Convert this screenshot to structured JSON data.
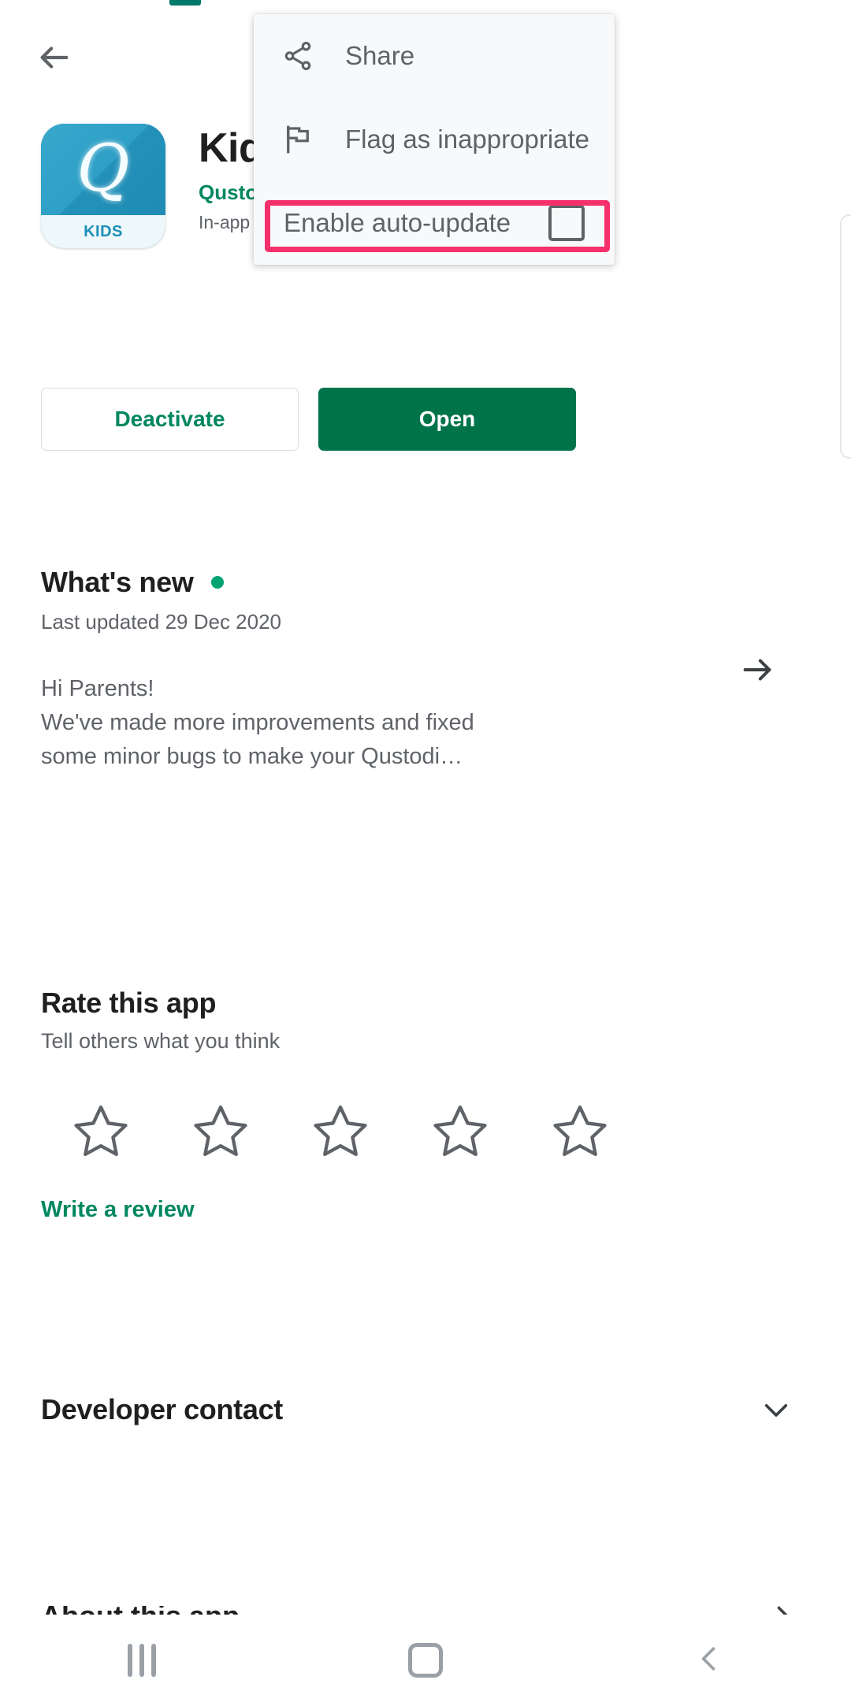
{
  "app": {
    "back_label": "Back",
    "title": "Kids",
    "developer": "Qustodio",
    "iap_note": "In-app purchases",
    "icon_letter": "Q",
    "icon_badge": "KIDS",
    "icon_color": "#2391b9"
  },
  "actions": {
    "secondary_label": "Deactivate",
    "primary_label": "Open",
    "primary_color": "#00734a",
    "accent_color": "#01875f"
  },
  "whats_new": {
    "title": "What's new",
    "updated": "Last updated 29 Dec 2020",
    "body_line1": "Hi Parents!",
    "body_line2": "We've made more improvements and fixed",
    "body_line3": "some minor bugs to make your Qustodi…",
    "new_dot_color": "#00a472"
  },
  "rate": {
    "title": "Rate this app",
    "subtitle": "Tell others what you think",
    "stars": [
      "star-1",
      "star-2",
      "star-3",
      "star-4",
      "star-5"
    ],
    "write_review_label": "Write a review"
  },
  "developer_contact": {
    "title": "Developer contact"
  },
  "partial_section": {
    "title": "About this app"
  },
  "menu": {
    "items": [
      {
        "label": "Share",
        "icon": "share-icon"
      },
      {
        "label": "Flag as inappropriate",
        "icon": "flag-icon"
      },
      {
        "label": "Enable auto-update",
        "icon": "checkbox",
        "checked": false
      }
    ],
    "background": "#f8f9fa"
  },
  "highlight": {
    "color": "#f5306b",
    "target": "Enable auto-update"
  },
  "navbar": {
    "recents_label": "Recents",
    "home_label": "Home",
    "back_label": "Back"
  }
}
